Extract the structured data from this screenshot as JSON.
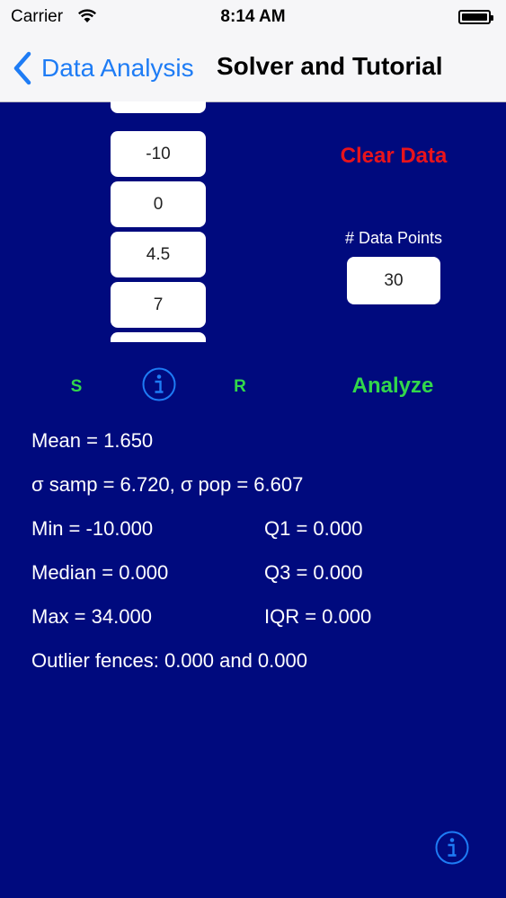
{
  "status_bar": {
    "carrier": "Carrier",
    "time": "8:14 AM"
  },
  "nav": {
    "back_label": "Data Analysis",
    "title": "Solver and Tutorial"
  },
  "data_entries": [
    "-10",
    "0",
    "4.5",
    "7"
  ],
  "actions": {
    "clear_data": "Clear Data",
    "analyze": "Analyze",
    "s_label": "S",
    "r_label": "R"
  },
  "data_points": {
    "label": "# Data Points",
    "value": "30"
  },
  "results": {
    "mean": "Mean = 1.650",
    "sigma": "σ samp = 6.720, σ pop = 6.607",
    "min": "Min = -10.000",
    "q1": "Q1 = 0.000",
    "median": "Median = 0.000",
    "q3": "Q3 = 0.000",
    "max": "Max = 34.000",
    "iqr": "IQR = 0.000",
    "fences": "Outlier fences: 0.000 and 0.000"
  },
  "colors": {
    "background": "#000a7e",
    "accent_blue": "#1e7cf5",
    "clear_red": "#e8141c",
    "action_green": "#32d74b"
  },
  "icons": [
    "wifi-icon",
    "battery-icon",
    "back-chevron-icon",
    "info-icon"
  ]
}
